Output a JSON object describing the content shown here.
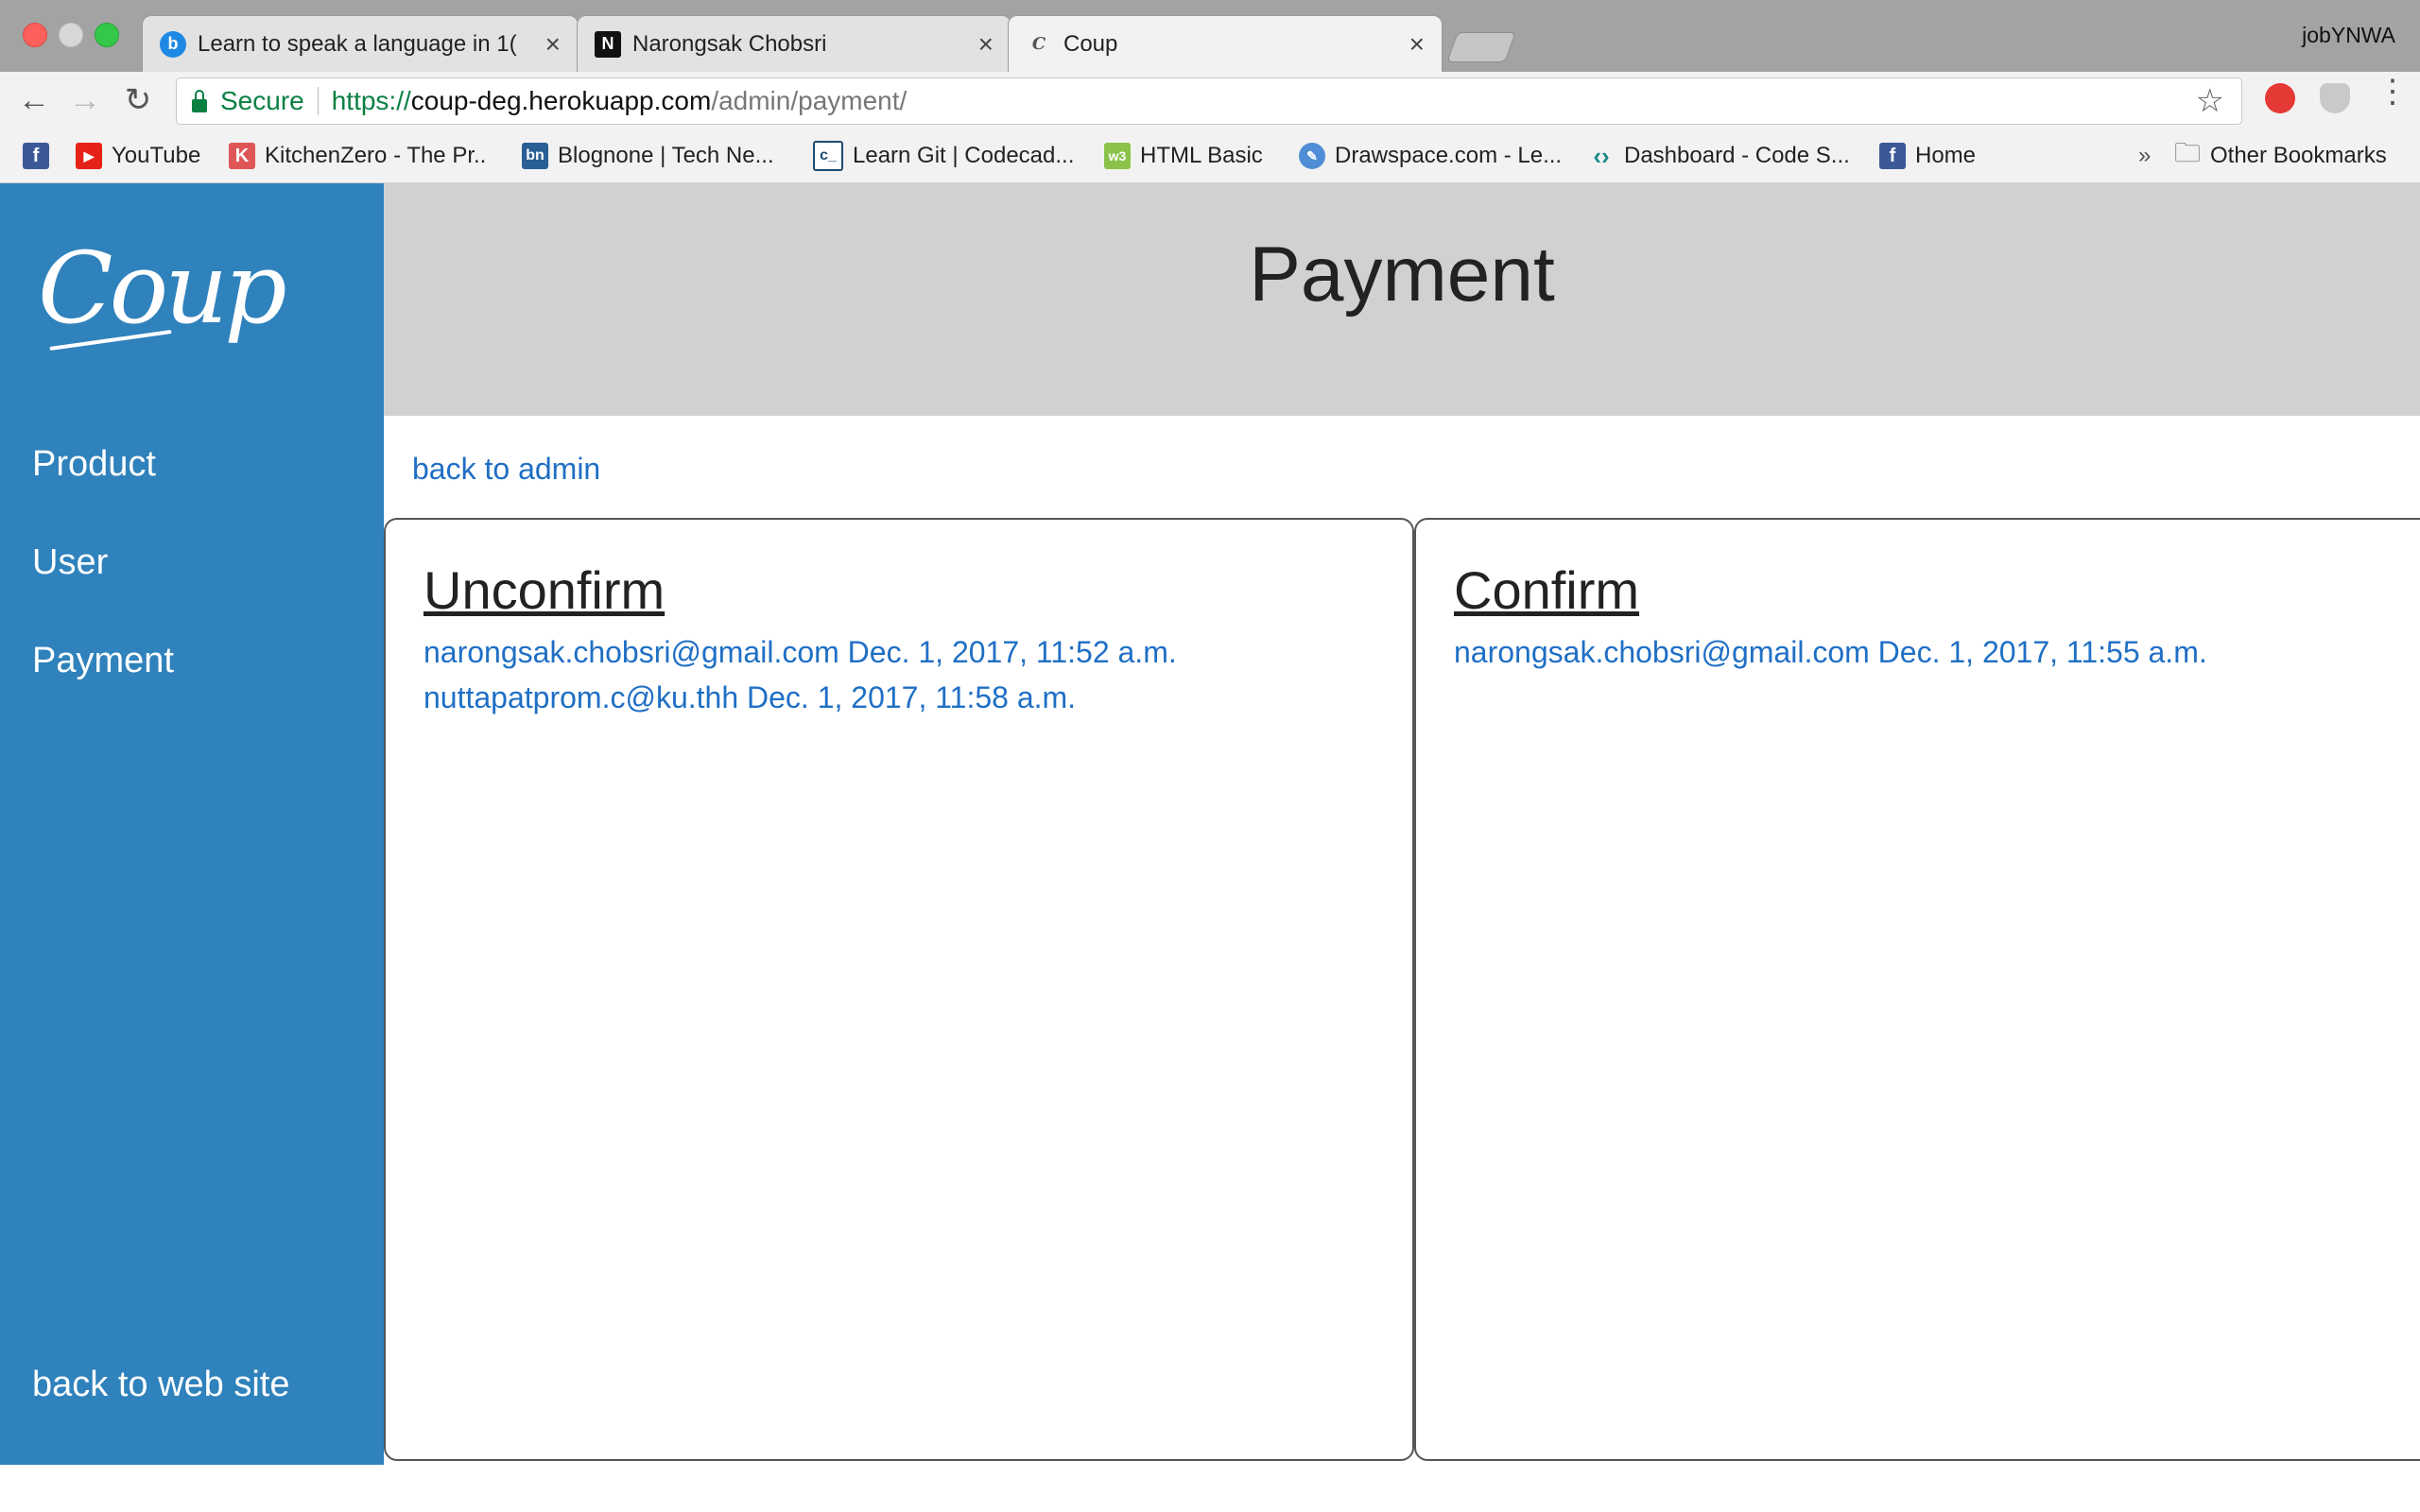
{
  "browser": {
    "tabs": [
      {
        "title": "Learn to speak a language in 1(",
        "favicon": "b",
        "active": false
      },
      {
        "title": "Narongsak Chobsri",
        "favicon": "N",
        "active": false
      },
      {
        "title": "Coup",
        "favicon": "C",
        "active": true
      }
    ],
    "profile": "jobYNWA",
    "address": {
      "secure_label": "Secure",
      "scheme": "https://",
      "host": "coup-deg.herokuapp.com",
      "path": "/admin/payment/"
    },
    "bookmarks": [
      {
        "label": "",
        "icon": "facebook-icon"
      },
      {
        "label": "YouTube",
        "icon": "youtube-icon"
      },
      {
        "label": "KitchenZero - The Pr..",
        "icon": "k-icon"
      },
      {
        "label": "Blognone | Tech Ne...",
        "icon": "bn-icon"
      },
      {
        "label": "Learn Git | Codecad...",
        "icon": "codecademy-icon"
      },
      {
        "label": "HTML Basic",
        "icon": "w3-icon"
      },
      {
        "label": "Drawspace.com - Le...",
        "icon": "drawspace-icon"
      },
      {
        "label": "Dashboard - Code S...",
        "icon": "code-icon"
      },
      {
        "label": "Home",
        "icon": "facebook-icon"
      }
    ],
    "overflow_label": "»",
    "other_bookmarks": "Other Bookmarks"
  },
  "sidebar": {
    "logo": "Coup",
    "items": [
      {
        "label": "Product"
      },
      {
        "label": "User"
      },
      {
        "label": "Payment"
      }
    ],
    "back_label": "back to web site"
  },
  "header": {
    "title": "Payment"
  },
  "main": {
    "back_link": "back to admin",
    "unconfirm": {
      "heading": "Unconfirm",
      "entries": [
        "narongsak.chobsri@gmail.com Dec. 1, 2017, 11:52 a.m.",
        "nuttapatprom.c@ku.thh Dec. 1, 2017, 11:58 a.m."
      ]
    },
    "confirm": {
      "heading": "Confirm",
      "entries": [
        "narongsak.chobsri@gmail.com Dec. 1, 2017, 11:55 a.m."
      ]
    }
  },
  "colors": {
    "sidebar": "#2f82bc",
    "header": "#d1d1d1",
    "link": "#1f6fc5",
    "secure": "#0b8043"
  }
}
